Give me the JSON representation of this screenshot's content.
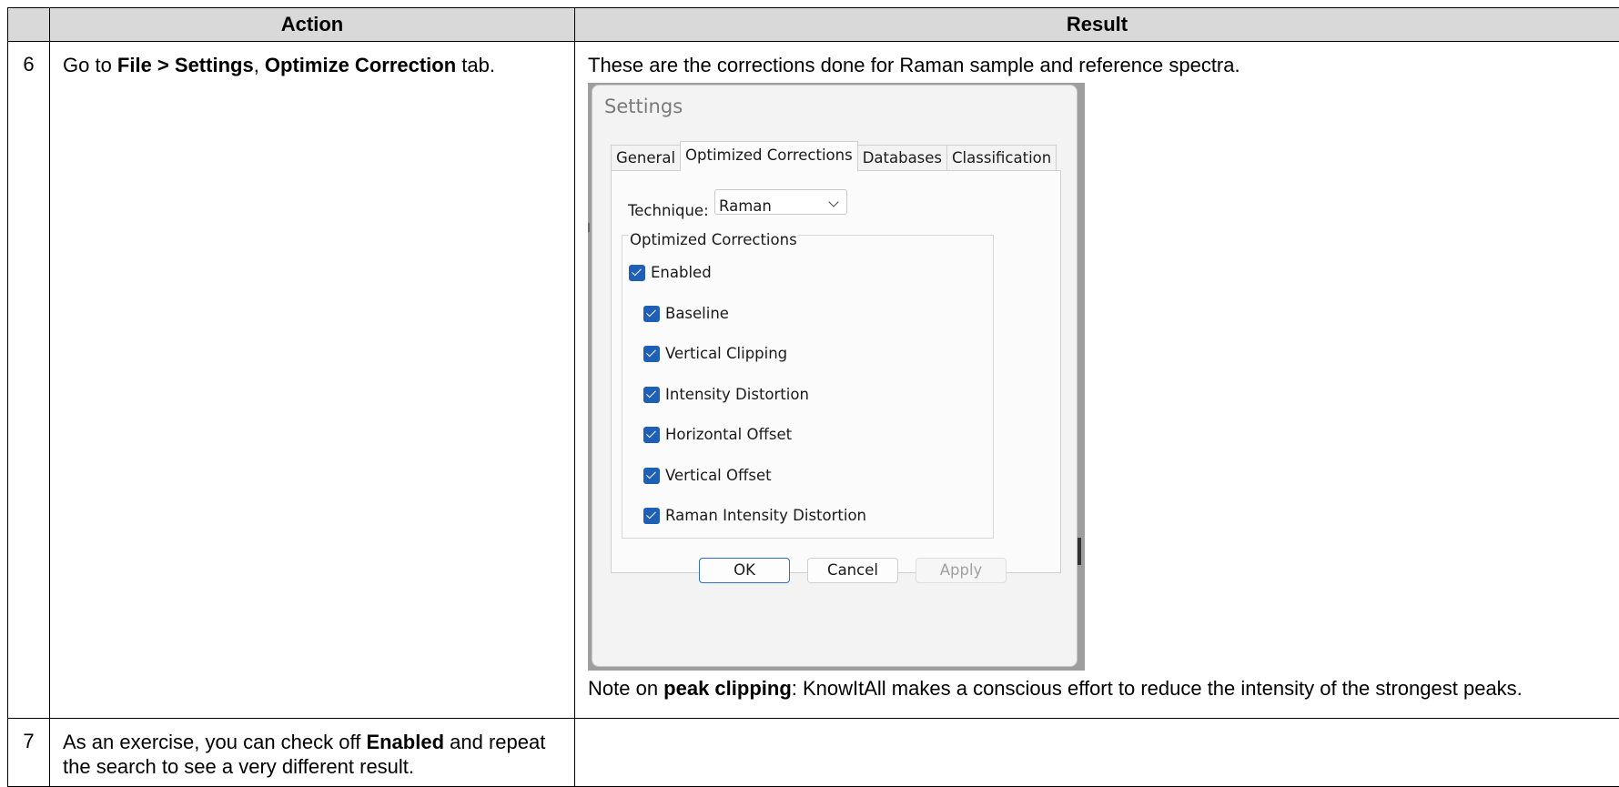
{
  "table": {
    "headers": [
      "",
      "Action",
      "Result"
    ],
    "rows": [
      {
        "number": "6",
        "action": {
          "prefix": "Go to ",
          "menu_path": "File > Settings",
          "comma": ", ",
          "tab_name": "Optimize Correction",
          "suffix": " tab."
        },
        "result": {
          "intro": "These are the corrections done for Raman sample and reference spectra.",
          "note_prefix": "Note on ",
          "note_bold": "peak clipping",
          "note_suffix": ": KnowItAll makes a conscious effort to reduce the intensity of the strongest peaks."
        }
      },
      {
        "number": "7",
        "action": {
          "prefix": "As an exercise, you can check off ",
          "bold": "Enabled",
          "suffix": " and repeat the search to see a very different result."
        },
        "result": {}
      }
    ]
  },
  "dialog": {
    "title": "Settings",
    "tabs": [
      "General",
      "Optimized Corrections",
      "Databases",
      "Classification"
    ],
    "active_tab": "Optimized Corrections",
    "technique_label": "Technique:",
    "technique_value": "Raman",
    "group_label": "Optimized Corrections",
    "enabled_label": "Enabled",
    "options": [
      {
        "label": "Baseline",
        "checked": true
      },
      {
        "label": "Vertical Clipping",
        "checked": true
      },
      {
        "label": "Intensity Distortion",
        "checked": true
      },
      {
        "label": "Horizontal Offset",
        "checked": true
      },
      {
        "label": "Vertical Offset",
        "checked": true
      },
      {
        "label": "Raman Intensity Distortion",
        "checked": true
      }
    ],
    "buttons": {
      "ok": "OK",
      "cancel": "Cancel",
      "apply": "Apply"
    },
    "colors": {
      "checkbox": "#1f5fb5",
      "ok_border": "#2f6fc4"
    }
  }
}
